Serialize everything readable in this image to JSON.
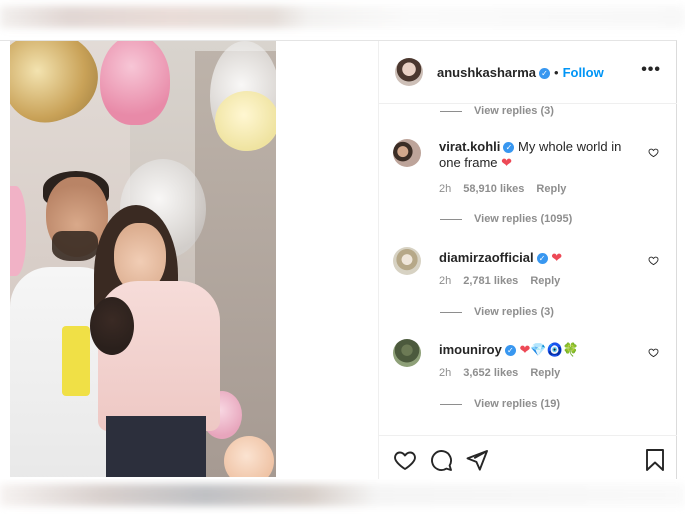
{
  "post": {
    "author": "anushkasharma",
    "separator": "•",
    "follow_label": "Follow",
    "more_label": "•••"
  },
  "comments": [
    {
      "type": "replies",
      "label": "View replies (3)"
    },
    {
      "username": "virat.kohli",
      "verified": true,
      "text": "My whole world in one frame",
      "emoji": "❤",
      "time": "2h",
      "likes": "58,910 likes",
      "reply": "Reply",
      "replies": "View replies (1095)"
    },
    {
      "username": "diamirzaofficial",
      "verified": true,
      "text": "",
      "emoji": "❤",
      "time": "2h",
      "likes": "2,781 likes",
      "reply": "Reply",
      "replies": "View replies (3)"
    },
    {
      "username": "imouniroy",
      "verified": true,
      "text": "",
      "emoji": "❤💎🧿🍀",
      "time": "2h",
      "likes": "3,652 likes",
      "reply": "Reply",
      "replies": "View replies (19)"
    }
  ],
  "colors": {
    "link": "#0095f6",
    "verified": "#3897f0",
    "heart": "#ed4956",
    "muted": "#8e8e8e"
  },
  "icons": [
    "like-icon",
    "comment-icon",
    "share-icon",
    "save-icon",
    "more-icon",
    "verified-icon"
  ]
}
